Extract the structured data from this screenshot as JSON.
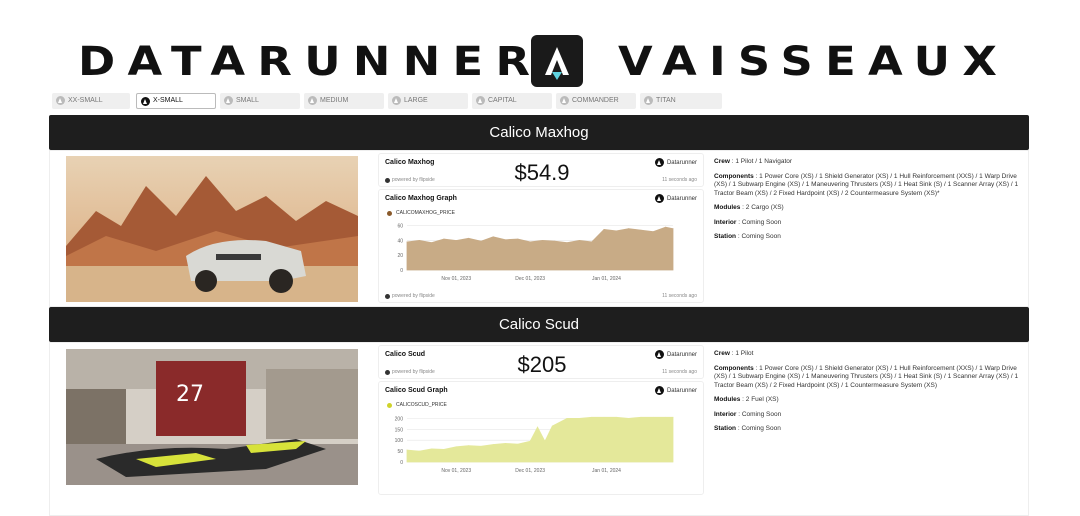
{
  "brand": {
    "left_word": "DATARUNNER",
    "right_word": "VAISSEAUX",
    "logo_icon": "datarunner-logo-icon"
  },
  "tabs": [
    {
      "label": "XX-SMALL",
      "active": false
    },
    {
      "label": "X-SMALL",
      "active": true
    },
    {
      "label": "SMALL",
      "active": false
    },
    {
      "label": "MEDIUM",
      "active": false
    },
    {
      "label": "LARGE",
      "active": false
    },
    {
      "label": "CAPITAL",
      "active": false
    },
    {
      "label": "COMMANDER",
      "active": false
    },
    {
      "label": "TITAN",
      "active": false
    }
  ],
  "ships": [
    {
      "name": "Calico Maxhog",
      "price_widget": {
        "title": "Calico Maxhog",
        "source": "Datarunner",
        "price": "$54.9",
        "powered": "powered by flipside",
        "time": "11 seconds ago"
      },
      "graph_widget": {
        "title": "Calico Maxhog Graph",
        "source": "Datarunner",
        "legend": "CALICOMAXHOG_PRICE",
        "powered": "powered by flipside",
        "time": "11 seconds ago"
      },
      "specs": [
        {
          "label": "Crew",
          "value": " : 1 Pilot / 1 Navigator"
        },
        {
          "label": "Components",
          "value": " : 1 Power Core (XS) / 1 Shield Generator (XS) / 1 Hull Reinforcement (XXS) / 1 Warp Drive (XS) / 1 Subwarp Engine (XS) / 1 Maneuvering Thrusters (XS) / 1 Heat Sink (S) / 1 Scanner Array (XS) / 1 Tractor Beam (XS) / 2 Fixed Hardpoint (XS) / 2 Countermeasure System (XS)*"
        },
        {
          "label": "Modules",
          "value": " : 2 Cargo (XS)"
        },
        {
          "label": "Interior",
          "value": " : Coming Soon"
        },
        {
          "label": "Station",
          "value": " : Coming Soon"
        }
      ]
    },
    {
      "name": "Calico Scud",
      "price_widget": {
        "title": "Calico Scud",
        "source": "Datarunner",
        "price": "$205",
        "powered": "powered by flipside",
        "time": "11 seconds ago"
      },
      "graph_widget": {
        "title": "Calico Scud Graph",
        "source": "Datarunner",
        "legend": "CALICOSCUD_PRICE",
        "powered": "",
        "time": ""
      },
      "specs": [
        {
          "label": "Crew",
          "value": " : 1 Pilot"
        },
        {
          "label": "Components",
          "value": " : 1 Power Core (XS) / 1 Shield Generator (XS) / 1 Hull Reinforcement (XXS) / 1 Warp Drive (XS) / 1 Subwarp Engine (XS) / 1 Maneuvering Thrusters (XS) / 1 Heat Sink (S) / 1 Scanner Array (XS) / 1 Tractor Beam (XS) / 2 Fixed Hardpoint (XS) / 1 Countermeasure System (XS)"
        },
        {
          "label": "Modules",
          "value": " : 2 Fuel (XS)"
        },
        {
          "label": "Interior",
          "value": " : Coming Soon"
        },
        {
          "label": "Station",
          "value": " : Coming Soon"
        }
      ]
    }
  ],
  "chart_data": [
    {
      "type": "area",
      "title": "Calico Maxhog Graph",
      "legend": [
        "CALICOMAXHOG_PRICE"
      ],
      "color": "#c8ab86",
      "marker_color": "#8a5a2b",
      "x_ticks": [
        "Nov 01, 2023",
        "Dec 01, 2023",
        "Jan 01, 2024"
      ],
      "y_ticks": [
        0,
        20,
        40,
        60
      ],
      "ylim": [
        0,
        65
      ],
      "x_range": [
        "2023-10-12",
        "2024-01-28"
      ],
      "x": [
        "2023-10-12",
        "2023-10-17",
        "2023-10-22",
        "2023-10-27",
        "2023-11-01",
        "2023-11-06",
        "2023-11-11",
        "2023-11-16",
        "2023-11-21",
        "2023-11-26",
        "2023-12-01",
        "2023-12-06",
        "2023-12-11",
        "2023-12-16",
        "2023-12-21",
        "2023-12-26",
        "2023-12-31",
        "2024-01-05",
        "2024-01-10",
        "2024-01-15",
        "2024-01-20",
        "2024-01-25",
        "2024-01-28"
      ],
      "values": [
        38,
        40,
        37,
        42,
        40,
        43,
        39,
        45,
        41,
        42,
        38,
        40,
        39,
        37,
        40,
        38,
        55,
        53,
        56,
        54,
        52,
        58,
        56
      ],
      "grid": true
    },
    {
      "type": "area",
      "title": "Calico Scud Graph",
      "legend": [
        "CALICOSCUD_PRICE"
      ],
      "color": "#e4e89a",
      "marker_color": "#cfd32b",
      "x_ticks": [
        "Nov 01, 2023",
        "Dec 01, 2023",
        "Jan 01, 2024"
      ],
      "y_ticks": [
        0,
        50,
        100,
        150,
        200
      ],
      "ylim": [
        0,
        220
      ],
      "x_range": [
        "2023-10-12",
        "2024-01-28"
      ],
      "x": [
        "2023-10-12",
        "2023-10-17",
        "2023-10-22",
        "2023-10-27",
        "2023-11-01",
        "2023-11-06",
        "2023-11-11",
        "2023-11-16",
        "2023-11-21",
        "2023-11-26",
        "2023-12-01",
        "2023-12-04",
        "2023-12-07",
        "2023-12-10",
        "2023-12-16",
        "2023-12-21",
        "2023-12-26",
        "2023-12-31",
        "2024-01-05",
        "2024-01-10",
        "2024-01-15",
        "2024-01-20",
        "2024-01-25",
        "2024-01-28"
      ],
      "values": [
        55,
        50,
        60,
        58,
        70,
        75,
        72,
        80,
        85,
        82,
        95,
        160,
        95,
        165,
        200,
        200,
        205,
        205,
        205,
        200,
        205,
        205,
        205,
        205
      ],
      "grid": true
    }
  ]
}
